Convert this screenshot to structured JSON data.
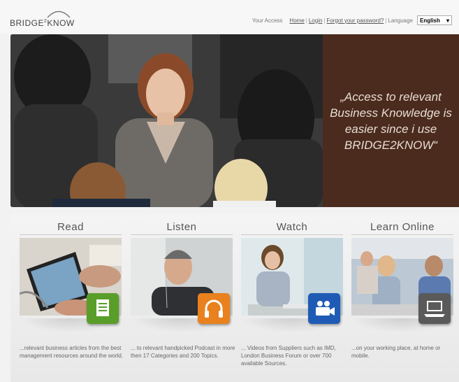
{
  "header": {
    "logo": {
      "text": "BRIDGE",
      "sup": "2",
      "text2": "KNOW"
    },
    "your_access_label": "Your Access",
    "nav": [
      {
        "label": "Home"
      },
      {
        "label": "Login"
      },
      {
        "label": "Forgot your password?"
      }
    ],
    "language_label": "Language",
    "language_value": "English"
  },
  "hero": {
    "quote": "„Access to relevant Business Knowledge is easier since i use BRIDGE2KNOW“"
  },
  "cards": [
    {
      "title": "Read",
      "icon": "document-icon",
      "icon_color": "#5a9e2a",
      "desc": "...relevant business articles from the best management resources around the world."
    },
    {
      "title": "Listen",
      "icon": "headphones-icon",
      "icon_color": "#e8811e",
      "desc": "... to relevant handpicked Podcast in more then 17 Categories and 200 Topics."
    },
    {
      "title": "Watch",
      "icon": "video-camera-icon",
      "icon_color": "#1f5bb5",
      "desc": "... Videos from Suppliers such as IMD, London Business Forum or over 700 available Sources."
    },
    {
      "title": "Learn Online",
      "icon": "laptop-icon",
      "icon_color": "#5a5a5a",
      "desc": "...on your working place, at home or mobile."
    }
  ]
}
